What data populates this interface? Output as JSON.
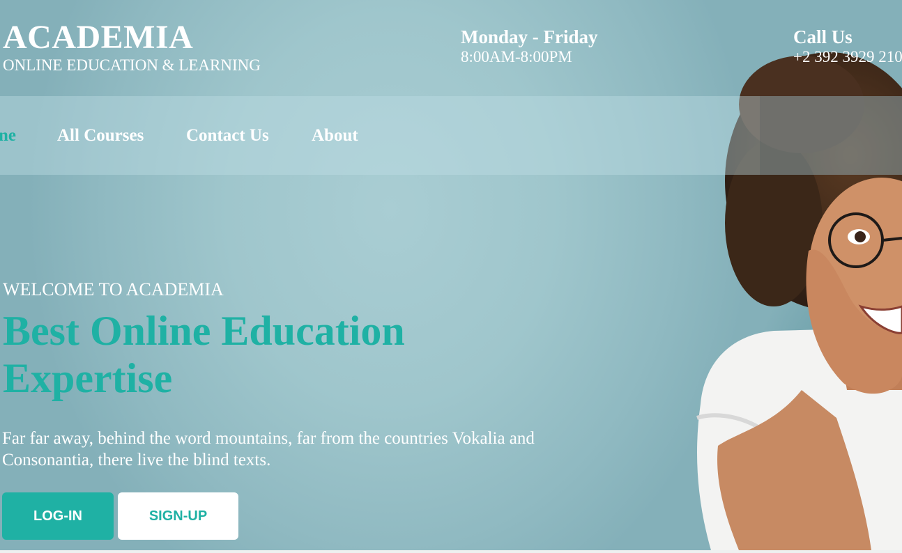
{
  "header": {
    "brand_title": "ACADEMIA",
    "brand_subtitle": "ONLINE EDUCATION & LEARNING",
    "hours_label": "Monday - Friday",
    "hours_value": "8:00AM-8:00PM",
    "call_label": "Call Us",
    "call_value": "+2 392 3929 210"
  },
  "nav": {
    "items": [
      {
        "label": "Home",
        "visible_text": "ne",
        "active": true
      },
      {
        "label": "All Courses"
      },
      {
        "label": "Contact Us"
      },
      {
        "label": "About"
      }
    ]
  },
  "hero": {
    "welcome": "WELCOME TO ACADEMIA",
    "headline": "Best Online Education Expertise",
    "blurb": "Far far away, behind the word mountains, far from the countries Vokalia and Consonantia, there live the blind texts.",
    "login_label": "LOG-IN",
    "signup_label": "SIGN-UP"
  },
  "colors": {
    "accent": "#1fb1a4",
    "text_light": "#ffffff",
    "hero_background": "#9fc6cc"
  }
}
